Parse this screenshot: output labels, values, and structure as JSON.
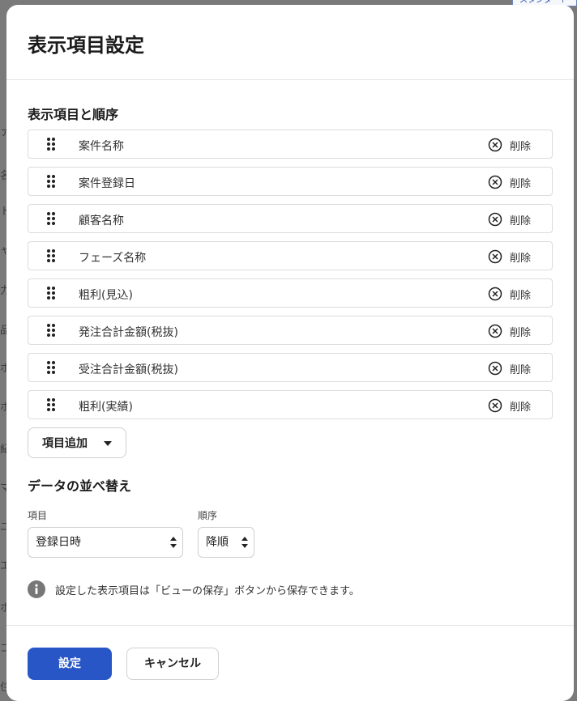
{
  "dialog": {
    "title": "表示項目設定",
    "section_display": "表示項目と順序",
    "items": [
      {
        "label": "案件名称",
        "delete_label": "削除"
      },
      {
        "label": "案件登録日",
        "delete_label": "削除"
      },
      {
        "label": "顧客名称",
        "delete_label": "削除"
      },
      {
        "label": "フェーズ名称",
        "delete_label": "削除"
      },
      {
        "label": "粗利(見込)",
        "delete_label": "削除"
      },
      {
        "label": "発注合計金額(税抜)",
        "delete_label": "削除"
      },
      {
        "label": "受注合計金額(税抜)",
        "delete_label": "削除"
      },
      {
        "label": "粗利(実績)",
        "delete_label": "削除"
      }
    ],
    "add_item_label": "項目追加",
    "section_sort": "データの並べ替え",
    "sort": {
      "field_label": "項目",
      "field_value": "登録日時",
      "order_label": "順序",
      "order_value": "降順"
    },
    "info_text": "設定した表示項目は「ビューの保存」ボタンから保存できます。",
    "submit_label": "設定",
    "cancel_label": "キャンセル"
  },
  "background": {
    "tab_label": "スタンダード",
    "edge_fragments": [
      "ァ",
      "名",
      "ト",
      "ャ",
      "力",
      "品",
      "ホ",
      "ホ",
      "紀",
      "マ",
      "ユ",
      "エ",
      "ホ",
      "コ",
      "住"
    ]
  },
  "colors": {
    "primary": "#2856c6",
    "overlay": "#7a7a7a",
    "border": "#dcdcdc"
  }
}
